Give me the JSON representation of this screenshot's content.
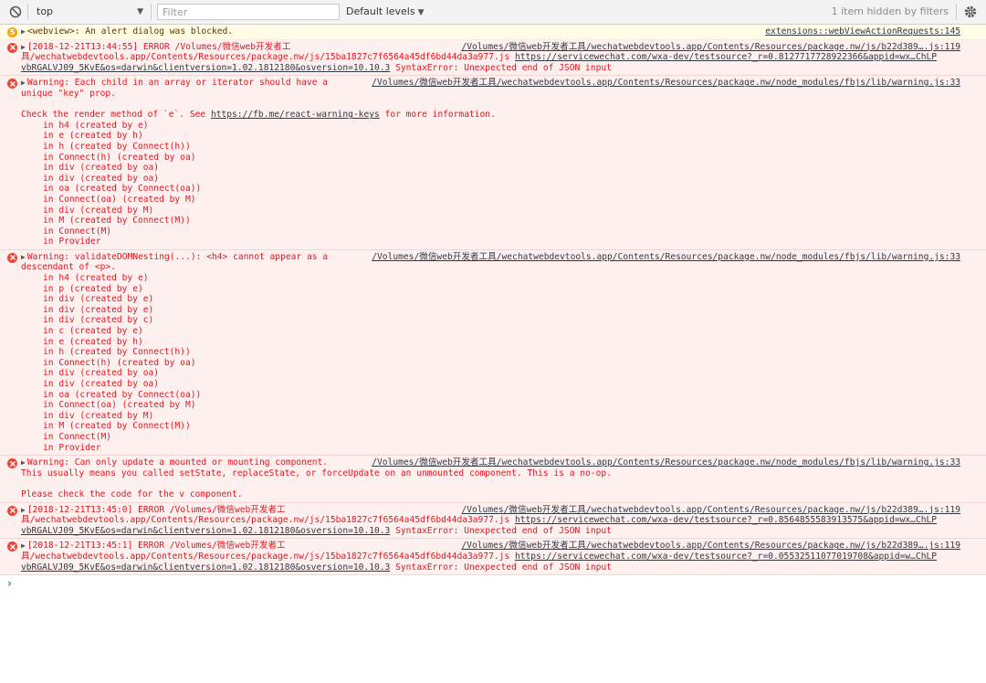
{
  "toolbar": {
    "context": "top",
    "filter_placeholder": "Filter",
    "levels": "Default levels",
    "hidden_info": "1 item hidden by filters"
  },
  "messages": {
    "alert": {
      "count": "5",
      "text": "<webview>: An alert dialog was blocked.",
      "source": "extensions::webViewActionRequests:145"
    },
    "err1": {
      "line1": "[2018-12-21T13:44:55] ERROR /Volumes/微信web开发者工",
      "line2": "具/wechatwebdevtools.app/Contents/Resources/package.nw/js/15ba1827c7f6564a45df6bd44da3a977.js",
      "link": "https://servicewechat.com/wxa-dev/testsource?_r=0.8127717728922366&appid=wx…ChLP",
      "line3": "vbRGALVJ09_5KvE&os=darwin&clientversion=1.02.1812180&osversion=10.10.3",
      "tail": " SyntaxError: Unexpected end of JSON input",
      "source": "/Volumes/微信web开发者工具/wechatwebdevtools.app/Contents/Resources/package.nw/js/b22d389….js:119"
    },
    "warn1": {
      "line1": "Warning: Each child in an array or iterator should have a",
      "line2": "unique \"key\" prop.",
      "check": "Check the render method of `e`. See ",
      "check_link": "https://fb.me/react-warning-keys",
      "check_tail": " for more information.",
      "stack": [
        "in h4 (created by e)",
        "in e (created by h)",
        "in h (created by Connect(h))",
        "in Connect(h) (created by oa)",
        "in div (created by oa)",
        "in div (created by oa)",
        "in oa (created by Connect(oa))",
        "in Connect(oa) (created by M)",
        "in div (created by M)",
        "in M (created by Connect(M))",
        "in Connect(M)",
        "in Provider"
      ],
      "source": "/Volumes/微信web开发者工具/wechatwebdevtools.app/Contents/Resources/package.nw/node_modules/fbjs/lib/warning.js:33"
    },
    "warn2": {
      "line1": "Warning: validateDOMNesting(...): <h4> cannot appear as a",
      "line2": "descendant of <p>.",
      "stack": [
        "in h4 (created by e)",
        "in p (created by e)",
        "in div (created by e)",
        "in div (created by e)",
        "in div (created by c)",
        "in c (created by e)",
        "in e (created by h)",
        "in h (created by Connect(h))",
        "in Connect(h) (created by oa)",
        "in div (created by oa)",
        "in div (created by oa)",
        "in oa (created by Connect(oa))",
        "in Connect(oa) (created by M)",
        "in div (created by M)",
        "in M (created by Connect(M))",
        "in Connect(M)",
        "in Provider"
      ],
      "source": "/Volumes/微信web开发者工具/wechatwebdevtools.app/Contents/Resources/package.nw/node_modules/fbjs/lib/warning.js:33"
    },
    "warn3": {
      "line1": "Warning: Can only update a mounted or mounting component.",
      "line2": "This usually means you called setState, replaceState, or forceUpdate on an unmounted component. This is a no-op.",
      "line3": "Please check the code for the v component.",
      "source": "/Volumes/微信web开发者工具/wechatwebdevtools.app/Contents/Resources/package.nw/node_modules/fbjs/lib/warning.js:33"
    },
    "err2": {
      "line1": "[2018-12-21T13:45:0] ERROR /Volumes/微信web开发者工",
      "line2": "具/wechatwebdevtools.app/Contents/Resources/package.nw/js/15ba1827c7f6564a45df6bd44da3a977.js",
      "link": "https://servicewechat.com/wxa-dev/testsource?_r=0.8564855583913575&appid=wx…ChLP",
      "line3": "vbRGALVJ09_5KvE&os=darwin&clientversion=1.02.1812180&osversion=10.10.3",
      "tail": " SyntaxError: Unexpected end of JSON input",
      "source": "/Volumes/微信web开发者工具/wechatwebdevtools.app/Contents/Resources/package.nw/js/b22d389….js:119"
    },
    "err3": {
      "line1": "[2018-12-21T13:45:1] ERROR /Volumes/微信web开发者工",
      "line2": "具/wechatwebdevtools.app/Contents/Resources/package.nw/js/15ba1827c7f6564a45df6bd44da3a977.js",
      "link": "https://servicewechat.com/wxa-dev/testsource?_r=0.05532511077019708&appid=w…ChLP",
      "line3": "vbRGALVJ09_5KvE&os=darwin&clientversion=1.02.1812180&osversion=10.10.3",
      "tail": " SyntaxError: Unexpected end of JSON input",
      "source": "/Volumes/微信web开发者工具/wechatwebdevtools.app/Contents/Resources/package.nw/js/b22d389….js:119"
    }
  },
  "prompt": "›"
}
